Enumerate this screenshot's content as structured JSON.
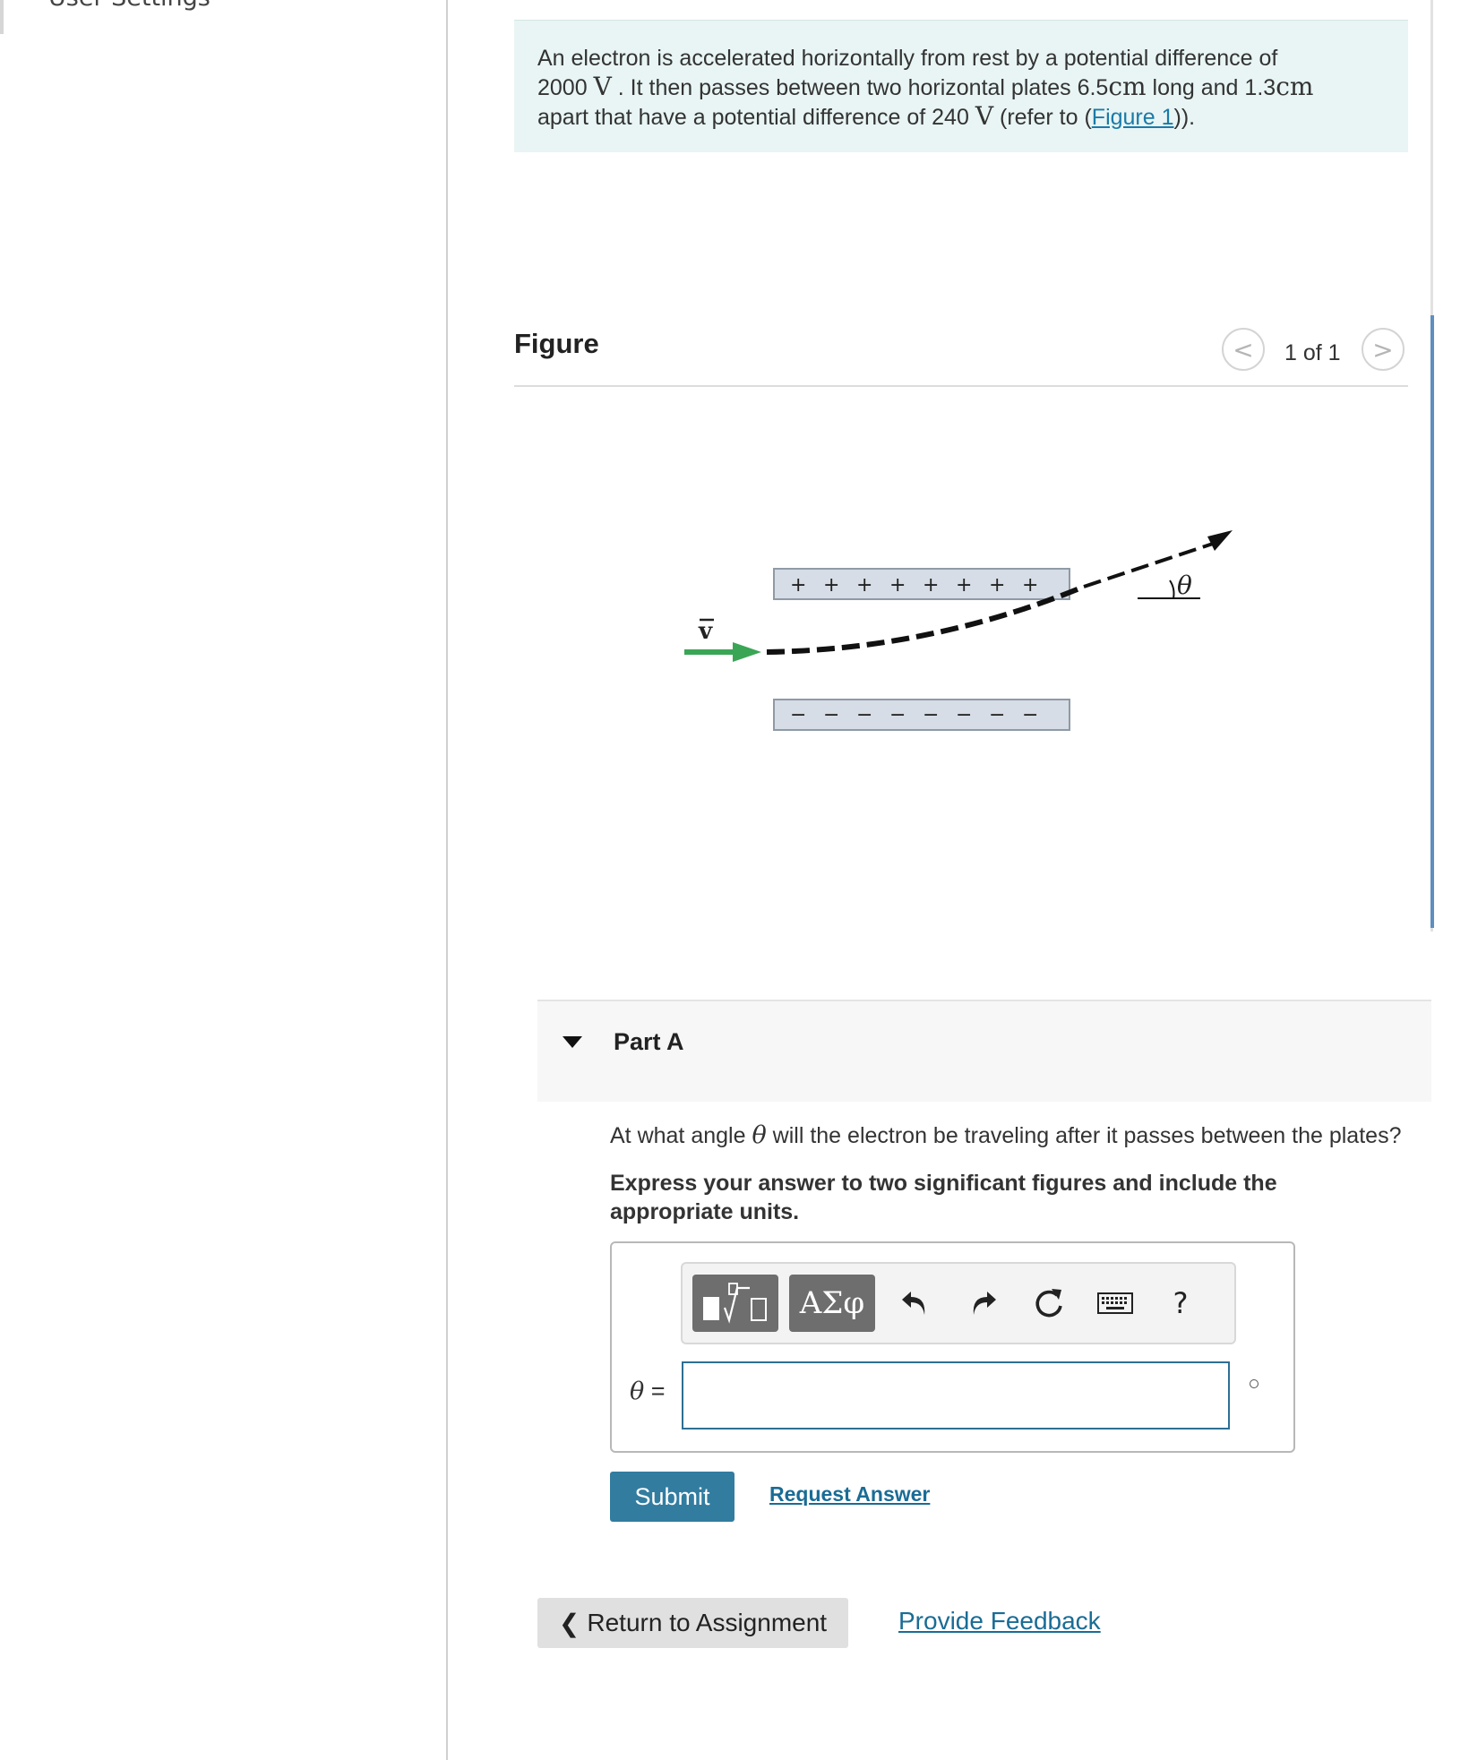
{
  "sidebar": {
    "item_label": "User Settings"
  },
  "problem": {
    "text_1": "An electron is accelerated horizontally from rest by a potential difference of",
    "value_voltage_1": "2000",
    "unit_v": "V",
    "text_2": ". It then passes between two horizontal plates",
    "value_length": "6.5",
    "unit_cm": "cm",
    "text_3": "long and",
    "value_gap": "1.3",
    "text_4": "apart that have a potential difference of",
    "value_voltage_2": "240",
    "text_5": "(refer to (",
    "figure_link": "Figure 1",
    "text_6": "))."
  },
  "figure": {
    "title": "Figure",
    "pager": "1 of 1",
    "prev_glyph": "<",
    "next_glyph": ">",
    "labels": {
      "velocity": "v",
      "angle": "θ",
      "plus_signs": [
        "+",
        "+",
        "+",
        "+",
        "+",
        "+",
        "+",
        "+"
      ],
      "minus_signs": [
        "−",
        "−",
        "−",
        "−",
        "−",
        "−",
        "−",
        "−"
      ]
    }
  },
  "part_a": {
    "title": "Part A",
    "question_before": "At what angle",
    "question_symbol": "θ",
    "question_after": "will the electron be traveling after it passes between the plates?",
    "instruction": "Express your answer to two significant figures and include the appropriate units.",
    "toolbar": {
      "templates_icon": "templates-icon",
      "greek_label": "ΑΣφ",
      "undo_icon": "undo-icon",
      "redo_icon": "redo-icon",
      "reset_icon": "reset-icon",
      "keyboard_icon": "keyboard-icon",
      "help_label": "?"
    },
    "answer_label_symbol": "θ",
    "answer_label_eq": " =",
    "answer_value": "",
    "unit_glyph": "degree-icon",
    "submit_label": "Submit",
    "request_answer_label": "Request Answer"
  },
  "footer": {
    "return_label": "Return to Assignment",
    "feedback_label": "Provide Feedback"
  },
  "colors": {
    "problem_bg": "#e8f5f4",
    "accent": "#327ca0",
    "link": "#1a6c95",
    "velocity_arrow": "#3aa655",
    "plate_fill": "#d6dde6"
  }
}
